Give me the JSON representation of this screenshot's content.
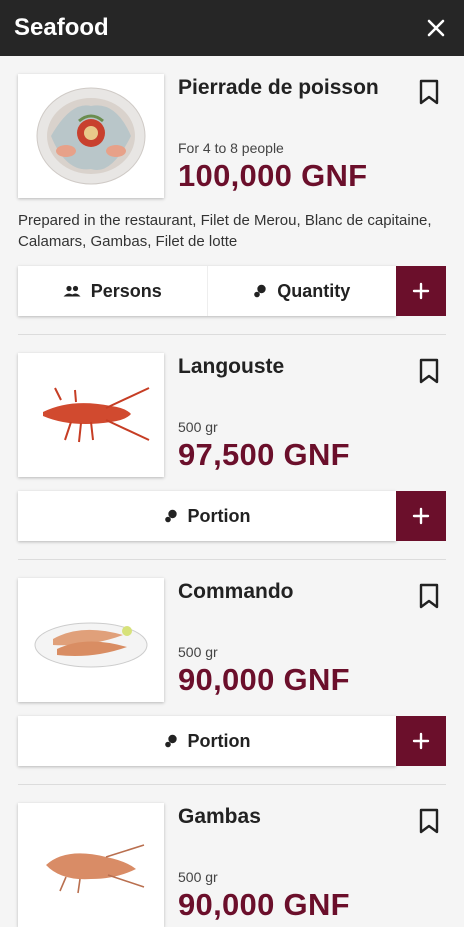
{
  "header": {
    "title": "Seafood"
  },
  "items": [
    {
      "name": "Pierrade de poisson",
      "subtitle": "For 4 to 8 people",
      "price": "100,000 GNF",
      "description": "Prepared in the restaurant, Filet de Merou, Blanc de capitaine, Calamars, Gambas, Filet de lotte",
      "buttons": [
        {
          "label": "Persons",
          "icon": "people-icon"
        },
        {
          "label": "Quantity",
          "icon": "portion-icon"
        }
      ]
    },
    {
      "name": "Langouste",
      "subtitle": "500 gr",
      "price": "97,500 GNF",
      "buttons": [
        {
          "label": "Portion",
          "icon": "portion-icon"
        }
      ]
    },
    {
      "name": "Commando",
      "subtitle": "500 gr",
      "price": "90,000 GNF",
      "buttons": [
        {
          "label": "Portion",
          "icon": "portion-icon"
        }
      ]
    },
    {
      "name": "Gambas",
      "subtitle": "500 gr",
      "price": "90,000 GNF"
    }
  ],
  "colors": {
    "accent": "#6b0f2b",
    "topbar": "#262626"
  }
}
